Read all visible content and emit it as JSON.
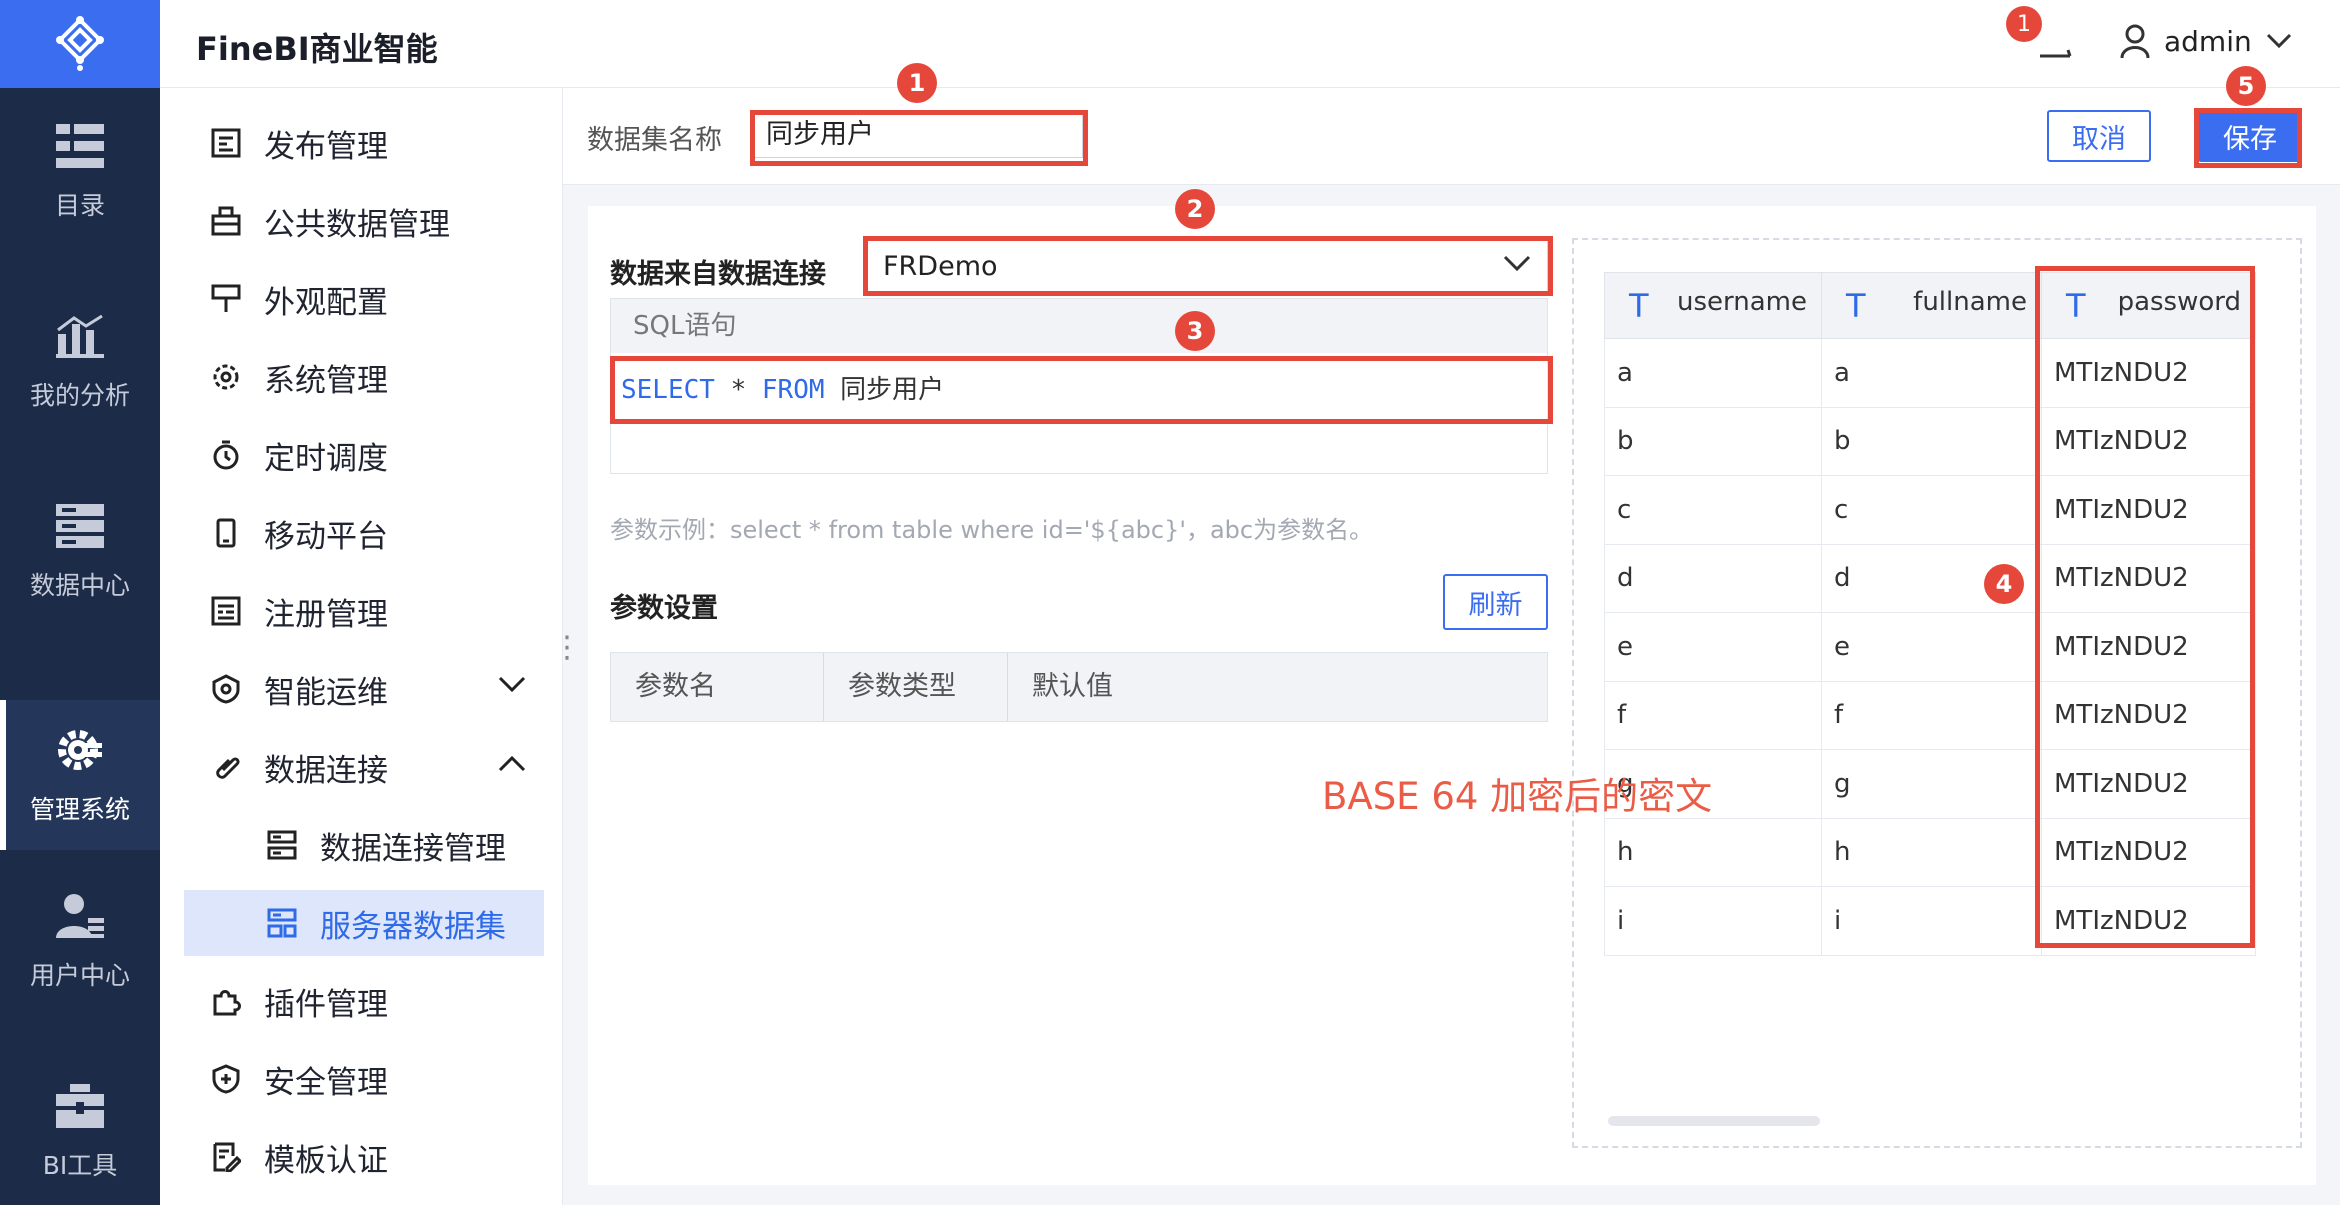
{
  "app": {
    "brand": "FineBI商业智能"
  },
  "header": {
    "notification_count": "1",
    "username": "admin"
  },
  "rail": {
    "items": [
      {
        "label": "目录",
        "icon": "list-icon"
      },
      {
        "label": "我的分析",
        "icon": "chart-icon"
      },
      {
        "label": "数据中心",
        "icon": "database-icon"
      },
      {
        "label": "管理系统",
        "icon": "gear-icon"
      },
      {
        "label": "用户中心",
        "icon": "user-icon"
      },
      {
        "label": "BI工具",
        "icon": "toolbox-icon"
      }
    ]
  },
  "sidebar": {
    "items": [
      {
        "label": "发布管理",
        "icon": "publish-icon"
      },
      {
        "label": "公共数据管理",
        "icon": "public-data-icon"
      },
      {
        "label": "外观配置",
        "icon": "paint-icon"
      },
      {
        "label": "系统管理",
        "icon": "settings-icon"
      },
      {
        "label": "定时调度",
        "icon": "timer-icon"
      },
      {
        "label": "移动平台",
        "icon": "mobile-icon"
      },
      {
        "label": "注册管理",
        "icon": "register-icon"
      },
      {
        "label": "智能运维",
        "icon": "ops-icon"
      },
      {
        "label": "数据连接",
        "icon": "link-icon"
      },
      {
        "label": "数据连接管理",
        "icon": "connection-icon"
      },
      {
        "label": "服务器数据集",
        "icon": "dataset-icon"
      },
      {
        "label": "插件管理",
        "icon": "plugin-icon"
      },
      {
        "label": "安全管理",
        "icon": "shield-icon"
      },
      {
        "label": "模板认证",
        "icon": "certificate-icon"
      }
    ]
  },
  "dataset": {
    "name_label": "数据集名称",
    "name_value": "同步用户",
    "cancel_label": "取消",
    "save_label": "保存"
  },
  "connection": {
    "label": "数据来自数据连接",
    "value": "FRDemo"
  },
  "sql": {
    "header": "SQL语句",
    "keyword_select": "SELECT",
    "star": "*",
    "keyword_from": "FROM",
    "table": "同步用户"
  },
  "params": {
    "tip": "参数示例：select * from table where id='${abc}'，abc为参数名。",
    "title": "参数设置",
    "refresh_label": "刷新",
    "columns": [
      "参数名",
      "参数类型",
      "默认值"
    ]
  },
  "preview": {
    "columns": [
      "username",
      "fullname",
      "password"
    ],
    "type_glyph": "T",
    "rows": [
      [
        "a",
        "a",
        "MTIzNDU2"
      ],
      [
        "b",
        "b",
        "MTIzNDU2"
      ],
      [
        "c",
        "c",
        "MTIzNDU2"
      ],
      [
        "d",
        "d",
        "MTIzNDU2"
      ],
      [
        "e",
        "e",
        "MTIzNDU2"
      ],
      [
        "f",
        "f",
        "MTIzNDU2"
      ],
      [
        "g",
        "g",
        "MTIzNDU2"
      ],
      [
        "h",
        "h",
        "MTIzNDU2"
      ],
      [
        "i",
        "i",
        "MTIzNDU2"
      ]
    ]
  },
  "annotations": {
    "markers": [
      "1",
      "2",
      "3",
      "4",
      "5"
    ],
    "caption": "BASE 64 加密后的密文",
    "color": "#e5483a"
  },
  "colors": {
    "accent": "#3b6df1",
    "rail_bg": "#1c2b48",
    "selected_bg": "#dde6fa"
  }
}
